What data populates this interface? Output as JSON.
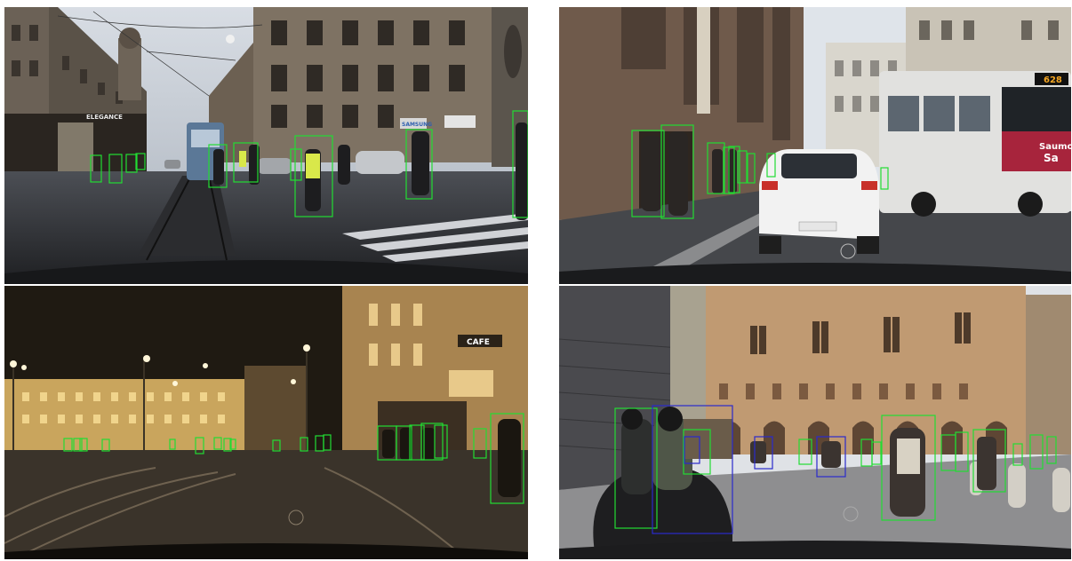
{
  "figure": {
    "layout": "2x2 grid of dashcam street images with pedestrian/cyclist detection boxes",
    "colors": {
      "pedestrian_box": "#22dd33",
      "rider_box": "#2a2acc",
      "background": "#ffffff"
    }
  },
  "panels": [
    {
      "id": "top-left",
      "scene": "daytime rainy city street with tram and pedestrians",
      "signs": [
        "ELEGANCE",
        "SAMSUNG"
      ]
    },
    {
      "id": "top-right",
      "scene": "narrow street with white car and city bus",
      "signs": [
        "628",
        "Saumon",
        "Sa"
      ]
    },
    {
      "id": "bottom-left",
      "scene": "night street with tram tracks and lit buildings",
      "signs": [
        "CAFE"
      ]
    },
    {
      "id": "bottom-right",
      "scene": "historic piazza with scooter riders and pedestrians",
      "signs": []
    }
  ]
}
